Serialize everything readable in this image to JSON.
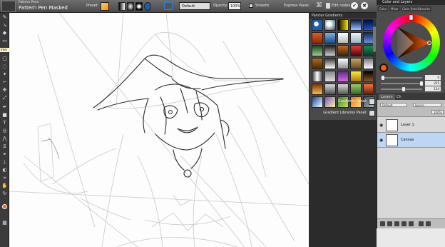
{
  "propbar": {
    "brush_category": "Pattern Pens",
    "brush_variant": "Pattern Pen Masked",
    "preset_label": "Preset:",
    "type_value": "Default",
    "opacity_label": "Opacity:",
    "opacity_value": "100%",
    "smooth_label": "Smooth",
    "express_label": "Express Panel:",
    "edit_nodes_label": "Edit nodes",
    "ok_glyph": "✔",
    "cancel_glyph": "✖"
  },
  "toolbox": {
    "hint_text": "Inter",
    "main_color": "#ff5a0a",
    "tools": [
      "brush-icon",
      "dropper-icon",
      "paint-bucket-icon",
      "eraser-icon",
      "gradient-icon",
      "select-rect-icon",
      "lasso-icon",
      "magic-wand-icon",
      "crop-icon",
      "move-icon",
      "transform-icon",
      "pen-icon",
      "shape-icon",
      "text-icon",
      "divine-proportion-icon",
      "perspective-icon",
      "mirror-icon",
      "kaleidoscope-icon",
      "cloner-icon",
      "rubber-stamp-icon",
      "dodge-icon",
      "blend-icon",
      "hand-icon",
      "zoom-icon",
      "rotate-icon"
    ]
  },
  "painter_gradients": {
    "title": "Painter Gradients",
    "gradients_panel_label": "Gradients Panel:",
    "gradient_libraries_label": "Gradient Libraries Panel:",
    "swatches": [
      "radial-gradient(circle at 40% 40%, #ffffff 25%, #1c5ea8 30%, #1c5ea8 100%)",
      "radial-gradient(circle at 40% 40%, #ffffff 25%, #d8e4f2 30%, #345 100%)",
      "linear-gradient(90deg,#000,#ffe600)",
      "linear-gradient(#0b1a4a,#9ec7ff)",
      "linear-gradient(#000a3c,#1f56c9)",
      "linear-gradient(#e85b1b,#8b2b05)",
      "linear-gradient(#7db0e6,#1d4e8c)",
      "linear-gradient(#ffffff,#b8b8b8)",
      "linear-gradient(#eef3f6,#9ab3c4)",
      "linear-gradient(#0f2a5e,#6b8ed6)",
      "linear-gradient(#1a3f25,#9bd08a)",
      "linear-gradient(#1d1d1d,#d0d0d0)",
      "linear-gradient(#c86a1e,#3a2410)",
      "linear-gradient(#eb3a3a,#4a0808)",
      "linear-gradient(#1e8a5a,#0a3a24)",
      "linear-gradient(#b26a1b,#4a2a0a)",
      "linear-gradient(#3a3a3a,#ffffff)",
      "linear-gradient(#ffffff,#8d8d8d)",
      "linear-gradient(#caa16a,#6b4a1a)",
      "linear-gradient(#777,#fff)",
      "linear-gradient(90deg,#444,#fff,#444)",
      "linear-gradient(#888,#ddd)",
      "linear-gradient(#5b2c8a,#d46adf)",
      "linear-gradient(#ffeb3b,#b07800)",
      "linear-gradient(#000,#8a5a2a)",
      "linear-gradient(#7a3b0a,#ffb74d)",
      "linear-gradient(#dcdcdc,#4e4e4e)",
      "linear-gradient(#ddd,#555)",
      "linear-gradient(#9ccc65,#33691e)",
      "linear-gradient(#ff7043,#5d1f0a)",
      "linear-gradient(135deg,#0d47a1,#fff)",
      "linear-gradient(135deg,#7e57c2,#fff59d)",
      "linear-gradient(135deg,#2e7d32,#d4e157)",
      "linear-gradient(135deg,#ef6c00,#ffe082)",
      "linear-gradient(135deg,#37474f,#b0bec5)"
    ]
  },
  "color_layers": {
    "title": "Color and Layers",
    "tabs": [
      "Color",
      "Mixer",
      "Color Sets/Libraries"
    ],
    "current_color": "#ff5a0a",
    "sliders": [
      {
        "value": "0"
      },
      {
        "value": "255"
      },
      {
        "value": "134"
      }
    ],
    "layers_tab": "Layers",
    "layers_tab2": "Ch",
    "blend_value": "Default",
    "composite_value": "Ignore",
    "opacity_value": "100%",
    "layers": [
      {
        "name": "Layer 1"
      },
      {
        "name": "Canvas"
      }
    ]
  }
}
